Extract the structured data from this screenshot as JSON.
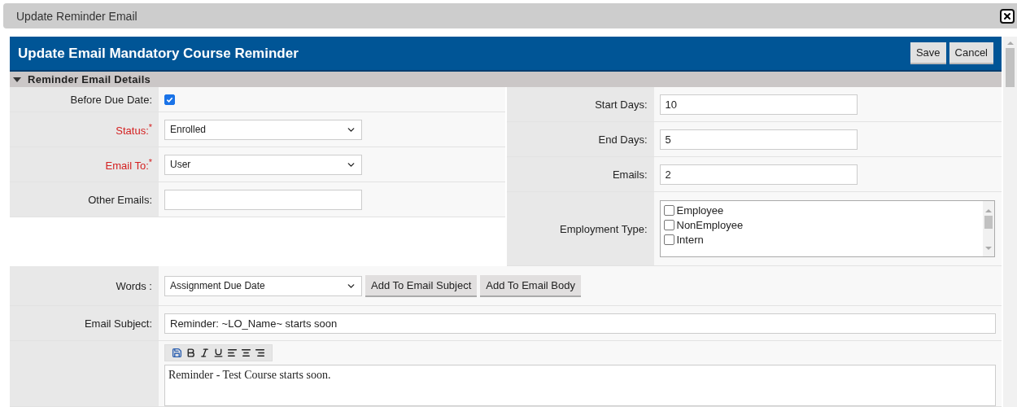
{
  "dialog": {
    "title": "Update Reminder Email"
  },
  "header": {
    "title": "Update Email Mandatory Course Reminder",
    "buttons": [
      "Save",
      "Cancel"
    ]
  },
  "section": {
    "title": "Reminder Email Details",
    "expanded": true
  },
  "left_fields": [
    {
      "kind": "checkbox",
      "label": "Before Due Date:",
      "required": false,
      "checked": true
    },
    {
      "kind": "select",
      "label": "Status:$^{*}$",
      "required": true,
      "value": "Enrolled"
    },
    {
      "kind": "select",
      "label": "Email To:$^{*}$",
      "required": true,
      "value": "User"
    },
    {
      "kind": "text",
      "label": "Other Emails:",
      "required": false
    }
  ],
  "right_fields": [
    {
      "kind": "text",
      "label": "Start Days:",
      "value": "10"
    },
    {
      "kind": "text",
      "label": "End Days:",
      "value": "5"
    },
    {
      "kind": "text",
      "label": "Emails:",
      "value": "2"
    },
    {
      "kind": "checklist",
      "label": "Employment Type:",
      "options": [
        {
          "label": "Employee",
          "checked": false
        },
        {
          "label": "NonEmployee",
          "checked": false
        },
        {
          "label": "Intern",
          "checked": false
        }
      ]
    }
  ],
  "words": {
    "label": "Words :",
    "value": "Assignment Due Date",
    "buttons": [
      "Add To Email Subject",
      "Add To Email Body"
    ]
  },
  "email_subject": {
    "label": "Email Subject:",
    "value": "Reminder: ~LO_Name~ starts soon"
  },
  "editor": {
    "body": "Reminder - Test Course starts soon."
  }
}
